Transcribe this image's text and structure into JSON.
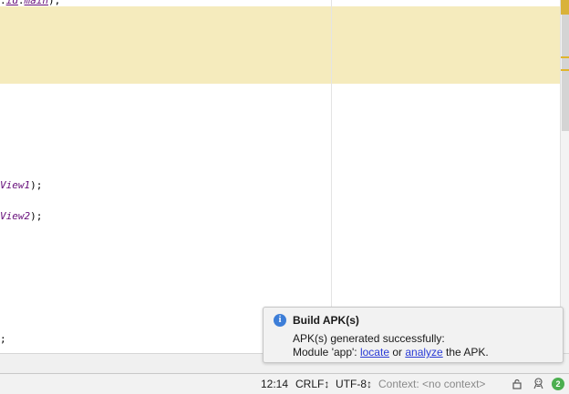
{
  "editor": {
    "lines": [
      {
        "pre": ".",
        "id": "id",
        "mid": ".",
        "id2": "main",
        "post": ");"
      },
      {
        "id": "View1",
        "post": ");"
      },
      {
        "id": "View2",
        "post": ");"
      },
      {
        "post": ";"
      }
    ]
  },
  "notification": {
    "icon": "info-icon",
    "title": "Build APK(s)",
    "message": "APK(s) generated successfully:",
    "module_prefix": "Module 'app': ",
    "link_locate": "locate",
    "separator": " or ",
    "link_analyze": "analyze",
    "suffix": " the APK."
  },
  "statusbar": {
    "position": "12:14",
    "line_separator": "CRLF↕",
    "encoding": "UTF-8↕",
    "context": "Context: <no context>",
    "lock_icon": "lock-icon",
    "inspector_icon": "hector-icon",
    "event_count": "2"
  },
  "colors": {
    "highlight": "#f5ebbd",
    "link": "#2a3bd6",
    "info": "#3d7ed8",
    "badge": "#4caf50",
    "identifier": "#660e7a"
  }
}
